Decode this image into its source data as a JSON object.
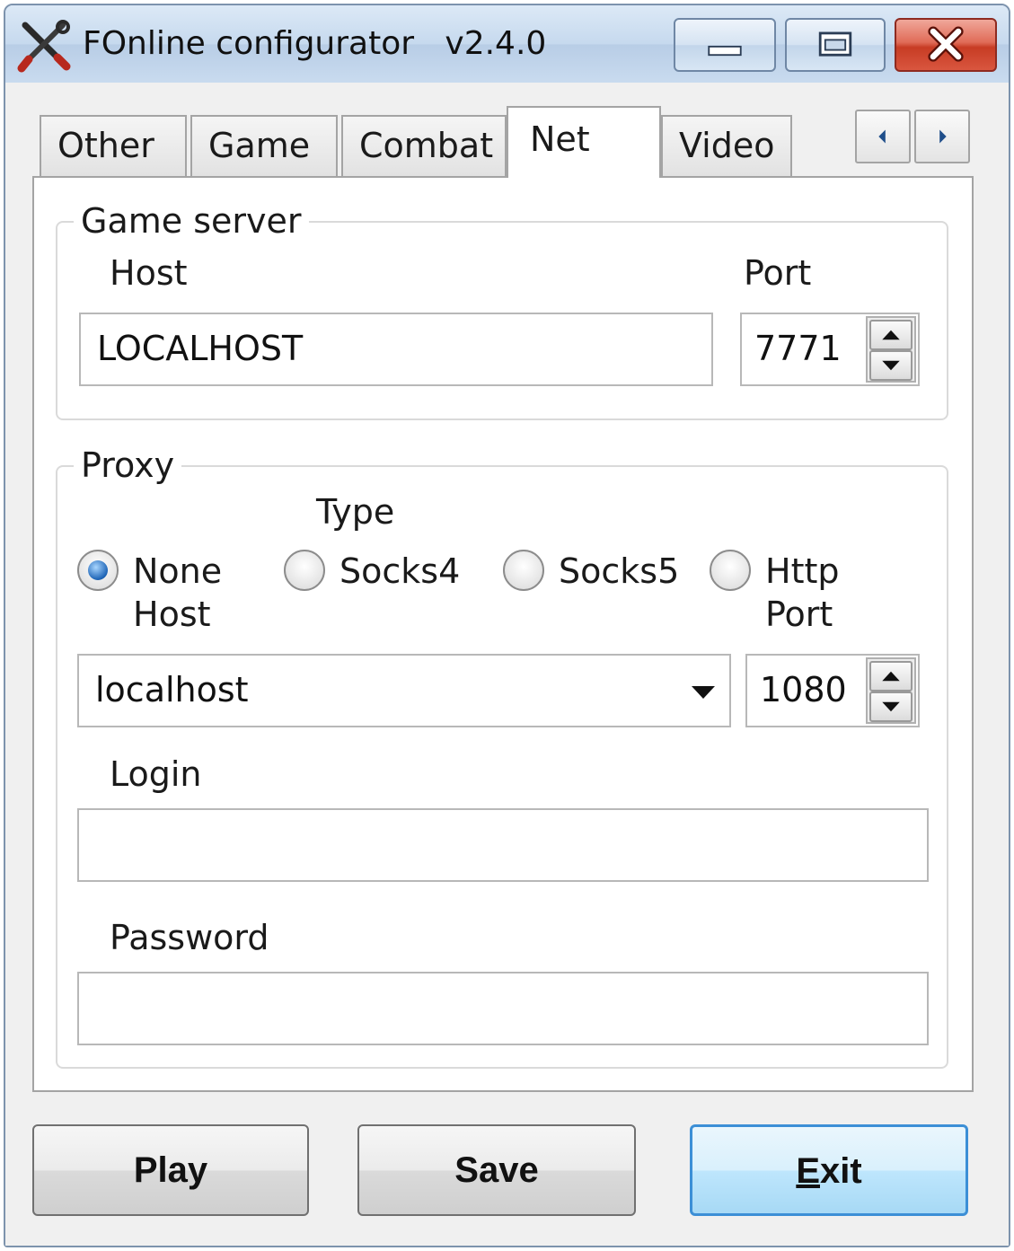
{
  "window": {
    "title": "FOnline configurator   v2.4.0",
    "icon": "crossed-tools-icon"
  },
  "title_controls": {
    "minimize_icon": "minimize-icon",
    "maximize_icon": "maximize-icon",
    "close_icon": "close-icon"
  },
  "tabs": [
    {
      "label": "Other",
      "active": false
    },
    {
      "label": "Game",
      "active": false
    },
    {
      "label": "Combat",
      "active": false
    },
    {
      "label": "Net",
      "active": true
    },
    {
      "label": "Video",
      "active": false
    }
  ],
  "tab_scroll": {
    "left_icon": "chevron-left-icon",
    "right_icon": "chevron-right-icon"
  },
  "game_server": {
    "legend": "Game server",
    "host_label": "Host",
    "host_value": "LOCALHOST",
    "port_label": "Port",
    "port_value": "7771"
  },
  "proxy": {
    "legend": "Proxy",
    "type_label": "Type",
    "types": [
      {
        "label": "None",
        "selected": true
      },
      {
        "label": "Socks4",
        "selected": false
      },
      {
        "label": "Socks5",
        "selected": false
      },
      {
        "label": "Http",
        "selected": false
      }
    ],
    "host_label": "Host",
    "host_value": "localhost",
    "port_label": "Port",
    "port_value": "1080",
    "login_label": "Login",
    "login_value": "",
    "password_label": "Password",
    "password_value": ""
  },
  "buttons": {
    "play": "Play",
    "save": "Save",
    "exit_mnemonic": "E",
    "exit_rest": "xit"
  },
  "colors": {
    "titlebar": "#c6d9ee",
    "close_button": "#c73c24",
    "radio_selected": "#1d64b6",
    "default_button_border": "#3c8fd6"
  }
}
